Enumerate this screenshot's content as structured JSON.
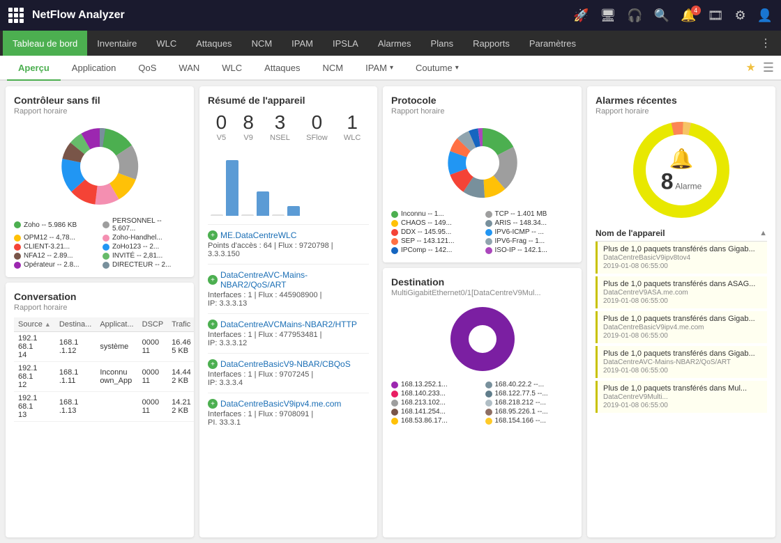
{
  "app": {
    "name": "NetFlow Analyzer"
  },
  "main_nav": {
    "items": [
      {
        "label": "Tableau de bord",
        "active": true
      },
      {
        "label": "Inventaire"
      },
      {
        "label": "WLC"
      },
      {
        "label": "Attaques"
      },
      {
        "label": "NCM"
      },
      {
        "label": "IPAM"
      },
      {
        "label": "IPSLA"
      },
      {
        "label": "Alarmes"
      },
      {
        "label": "Plans"
      },
      {
        "label": "Rapports"
      },
      {
        "label": "Paramètres"
      }
    ]
  },
  "sub_nav": {
    "items": [
      {
        "label": "Aperçu",
        "active": true
      },
      {
        "label": "Application"
      },
      {
        "label": "QoS"
      },
      {
        "label": "WAN"
      },
      {
        "label": "WLC"
      },
      {
        "label": "Attaques"
      },
      {
        "label": "NCM"
      },
      {
        "label": "IPAM",
        "dropdown": true
      },
      {
        "label": "Coutume",
        "dropdown": true
      }
    ]
  },
  "wireless": {
    "title": "Contrôleur sans fil",
    "subtitle": "Rapport horaire",
    "legend": [
      {
        "label": "Zoho -- 5.986 KB",
        "color": "#4CAF50"
      },
      {
        "label": "PERSONNEL -- 5.607...",
        "color": "#9E9E9E"
      },
      {
        "label": "OPM12 -- 4,78...",
        "color": "#FFC107"
      },
      {
        "label": "Zoho-Handhel...",
        "color": "#F48FB1"
      },
      {
        "label": "CLIENT-3.21...",
        "color": "#F44336"
      },
      {
        "label": "ZoHo123 -- 2...",
        "color": "#2196F3"
      },
      {
        "label": "NFA12 -- 2.89...",
        "color": "#795548"
      },
      {
        "label": "INVITÉ -- 2,81...",
        "color": "#66BB6A"
      },
      {
        "label": "Opérateur -- 2.8...",
        "color": "#9C27B0"
      },
      {
        "label": "DIRECTEUR -- 2...",
        "color": "#78909C"
      }
    ],
    "pie_slices": [
      {
        "color": "#4CAF50",
        "pct": 18
      },
      {
        "color": "#9E9E9E",
        "pct": 14
      },
      {
        "color": "#FFC107",
        "pct": 12
      },
      {
        "color": "#F48FB1",
        "pct": 10
      },
      {
        "color": "#F44336",
        "pct": 9
      },
      {
        "color": "#2196F3",
        "pct": 8
      },
      {
        "color": "#795548",
        "pct": 7
      },
      {
        "color": "#66BB6A",
        "pct": 7
      },
      {
        "color": "#9C27B0",
        "pct": 8
      },
      {
        "color": "#78909C",
        "pct": 7
      }
    ]
  },
  "device_summary": {
    "title": "Résumé de l'appareil",
    "stats": [
      {
        "value": "0",
        "label": "V5"
      },
      {
        "value": "8",
        "label": "V9"
      },
      {
        "value": "3",
        "label": "NSEL"
      },
      {
        "value": "0",
        "label": "SFlow"
      },
      {
        "value": "1",
        "label": "WLC"
      }
    ],
    "bars": [
      {
        "height": 80,
        "label": "V9"
      },
      {
        "height": 0,
        "label": ""
      },
      {
        "height": 30,
        "label": "NSEL"
      },
      {
        "height": 0,
        "label": ""
      },
      {
        "height": 12,
        "label": "WLC"
      }
    ],
    "devices": [
      {
        "name": "ME.DataCentreWLC",
        "info": "Points d'accès : 64 | Flux : 9720798 |",
        "ip": "3.3.3.150"
      },
      {
        "name": "DataCentreAVC-Mains-NBAR2/QoS/ART",
        "info": "Interfaces : 1 | Flux : 445908900 |",
        "ip": "IP: 3.3.3.13"
      },
      {
        "name": "DataCentreAVCMains-NBAR2/HTTP",
        "info": "Interfaces : 1 | Flux : 477953481 |",
        "ip": "IP: 3.3.3.12"
      },
      {
        "name": "DataCentreBasicV9-NBAR/CBQoS",
        "info": "Interfaces : 1 | Flux : 9707245 |",
        "ip": "IP: 3.3.3.4"
      },
      {
        "name": "DataCentreBasicV9ipv4.me.com",
        "info": "Interfaces : 1 | Flux : 9708091 |",
        "ip": "PI. 33.3.1"
      }
    ]
  },
  "conversation": {
    "title": "Conversation",
    "subtitle": "Rapport horaire",
    "columns": [
      "Source",
      "Destina...",
      "Applicat...",
      "DSCP",
      "Trafic"
    ],
    "rows": [
      {
        "source": "192.1 68.1 14",
        "dest": "168.1 .1.12",
        "app": "système",
        "dscp": "0000 11",
        "traffic": "16.46 5 KB"
      },
      {
        "source": "192.1 68.1 12",
        "dest": "168.1 .1.11",
        "app": "Inconnu own_App",
        "dscp": "0000 11",
        "traffic": "14.44 2 KB"
      },
      {
        "source": "192.1 68.1 13",
        "dest": "168.1 .1.13",
        "app": "",
        "dscp": "0000 11",
        "traffic": "14.21 2 KB"
      }
    ]
  },
  "protocol": {
    "title": "Protocole",
    "subtitle": "Rapport horaire",
    "legend": [
      {
        "label": "Inconnu -- 1...",
        "color": "#4CAF50"
      },
      {
        "label": "TCP -- 1.401 MB",
        "color": "#9E9E9E"
      },
      {
        "label": "CHAOS -- 149...",
        "color": "#FFC107"
      },
      {
        "label": "ARIS -- 148.34...",
        "color": "#78909C"
      },
      {
        "label": "DDX -- 145.95...",
        "color": "#F44336"
      },
      {
        "label": "IPV6-ICMP -- ...",
        "color": "#2196F3"
      },
      {
        "label": "SEP -- 143.121...",
        "color": "#FF7043"
      },
      {
        "label": "IPV6-Frag -- 1...",
        "color": "#90A4AE"
      },
      {
        "label": "IPComp -- 142...",
        "color": "#1565C0"
      },
      {
        "label": "ISO-IP -- 142.1...",
        "color": "#AB47BC"
      }
    ],
    "pie_slices": [
      {
        "color": "#4CAF50",
        "pct": 22
      },
      {
        "color": "#9E9E9E",
        "pct": 18
      },
      {
        "color": "#FFC107",
        "pct": 14
      },
      {
        "color": "#78909C",
        "pct": 12
      },
      {
        "color": "#F44336",
        "pct": 10
      },
      {
        "color": "#2196F3",
        "pct": 8
      },
      {
        "color": "#FF7043",
        "pct": 6
      },
      {
        "color": "#90A4AE",
        "pct": 4
      },
      {
        "color": "#1565C0",
        "pct": 3
      },
      {
        "color": "#AB47BC",
        "pct": 3
      }
    ]
  },
  "destination": {
    "title": "Destination",
    "subtitle": "MultiGigabitEthernet0/1[DataCentreV9Mul...",
    "legend": [
      {
        "label": "168.13.252.1...",
        "color": "#9C27B0"
      },
      {
        "label": "168.40.22.2 --...",
        "color": "#78909C"
      },
      {
        "label": "168.140.233...",
        "color": "#E91E63"
      },
      {
        "label": "168.122.77.5 --...",
        "color": "#607D8B"
      },
      {
        "label": "168.213.102...",
        "color": "#9E9E9E"
      },
      {
        "label": "168.218.212 --...",
        "color": "#B0BEC5"
      },
      {
        "label": "168.141.254...",
        "color": "#795548"
      },
      {
        "label": "168.95.226.1 --...",
        "color": "#8D6E63"
      },
      {
        "label": "168.53.86.17...",
        "color": "#FFC107"
      },
      {
        "label": "168.154.166 --...",
        "color": "#FFCA28"
      }
    ]
  },
  "alarms": {
    "title": "Alarmes récentes",
    "subtitle": "Rapport horaire",
    "gauge_count": "8",
    "gauge_label": "Alarme",
    "device_header": "Nom de l'appareil",
    "items": [
      {
        "title": "Plus de 1,0 paquets transférés dans Gigab...",
        "device": "DataCentreBasicV9ipv8tov4",
        "time": "2019-01-08 06:55:00"
      },
      {
        "title": "Plus de 1,0 paquets transférés dans ASAG...",
        "device": "DataCentreV9ASA.me.com",
        "time": "2019-01-08 06:55:00"
      },
      {
        "title": "Plus de 1,0 paquets transférés dans Gigab...",
        "device": "DataCentreBasicV9ipv4.me.com",
        "time": "2019-01-08 06:55:00"
      },
      {
        "title": "Plus de 1,0 paquets transférés dans Gigab...",
        "device": "DataCentreAVC-Mains-NBAR2/QoS/ART",
        "time": "2019-01-08 06:55:00"
      },
      {
        "title": "Plus de 1,0 paquets transférés dans Mul...",
        "device": "DataCentreV9Multi...",
        "time": "2019-01-08 06:55:00"
      }
    ]
  }
}
